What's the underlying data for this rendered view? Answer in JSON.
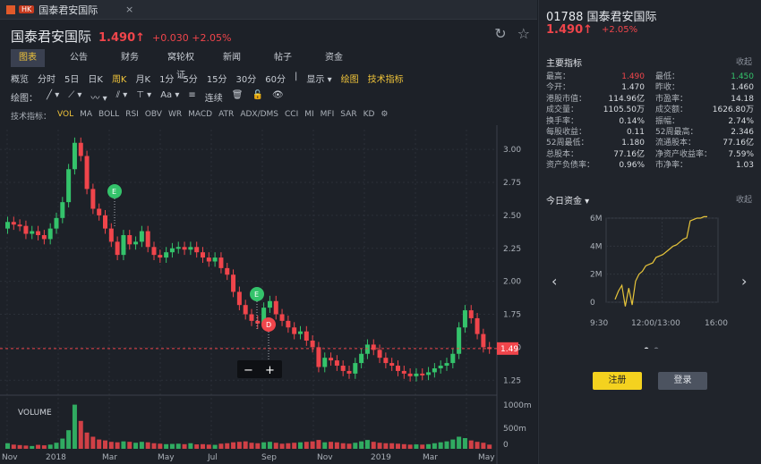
{
  "window": {
    "tab_badge": "HK",
    "title": "国泰君安国际",
    "close": "×"
  },
  "header": {
    "name": "国泰君安国际",
    "price": "1.490↑",
    "change": "+0.030 +2.05%"
  },
  "tabs": [
    "图表",
    "公告",
    "财务",
    "窝轮权证",
    "新闻",
    "帖子",
    "资金"
  ],
  "periods": [
    "概览",
    "分时",
    "5日",
    "日K",
    "周K",
    "月K",
    "1分",
    "5分",
    "15分",
    "30分",
    "60分",
    "|",
    "显示 ▾",
    "绘图",
    "技术指标"
  ],
  "draw": {
    "label": "绘图：",
    "connect": "连续"
  },
  "indicators": {
    "label": "技术指标：",
    "items": [
      "VOL",
      "MA",
      "BOLL",
      "RSI",
      "OBV",
      "WR",
      "MACD",
      "ATR",
      "ADX/DMS",
      "CCI",
      "MI",
      "MFI",
      "SAR",
      "KD"
    ]
  },
  "chart_data": {
    "type": "candlestick",
    "y_ticks": [
      "3.00",
      "2.75",
      "2.50",
      "2.25",
      "2.00",
      "1.75",
      "1.50",
      "1.25"
    ],
    "ylim": [
      1.15,
      3.15
    ],
    "current_price_label": "1.49",
    "volume_label": "VOLUME",
    "volume_ticks": [
      "1000m",
      "500m",
      "0"
    ],
    "x_labels": [
      "Nov",
      "2018",
      "Mar",
      "May",
      "Jul",
      "Sep",
      "Nov",
      "2019",
      "Mar",
      "May"
    ],
    "markers": [
      "E",
      "E",
      "D"
    ],
    "closes": [
      2.45,
      2.43,
      2.42,
      2.36,
      2.38,
      2.35,
      2.32,
      2.4,
      2.48,
      2.6,
      2.85,
      3.05,
      2.95,
      2.7,
      2.55,
      2.5,
      2.4,
      2.3,
      2.2,
      2.35,
      2.28,
      2.3,
      2.38,
      2.26,
      2.2,
      2.18,
      2.22,
      2.25,
      2.26,
      2.24,
      2.26,
      2.22,
      2.18,
      2.15,
      2.18,
      2.1,
      2.05,
      1.92,
      1.82,
      1.75,
      1.7,
      1.68,
      1.8,
      1.85,
      1.75,
      1.7,
      1.65,
      1.6,
      1.62,
      1.55,
      1.5,
      1.35,
      1.42,
      1.4,
      1.36,
      1.32,
      1.3,
      1.38,
      1.45,
      1.52,
      1.48,
      1.42,
      1.38,
      1.36,
      1.32,
      1.3,
      1.28,
      1.3,
      1.29,
      1.31,
      1.34,
      1.36,
      1.38,
      1.45,
      1.65,
      1.78,
      1.72,
      1.6,
      1.5,
      1.49
    ],
    "opens": [
      2.4,
      2.45,
      2.43,
      2.42,
      2.36,
      2.38,
      2.35,
      2.32,
      2.4,
      2.48,
      2.6,
      2.85,
      3.05,
      2.95,
      2.7,
      2.55,
      2.5,
      2.4,
      2.3,
      2.2,
      2.35,
      2.28,
      2.3,
      2.38,
      2.26,
      2.2,
      2.18,
      2.22,
      2.25,
      2.26,
      2.24,
      2.26,
      2.22,
      2.18,
      2.15,
      2.18,
      2.1,
      2.05,
      1.92,
      1.82,
      1.75,
      1.7,
      1.68,
      1.8,
      1.85,
      1.75,
      1.7,
      1.65,
      1.6,
      1.62,
      1.55,
      1.5,
      1.35,
      1.42,
      1.4,
      1.36,
      1.32,
      1.3,
      1.38,
      1.45,
      1.52,
      1.48,
      1.42,
      1.38,
      1.36,
      1.32,
      1.3,
      1.28,
      1.3,
      1.29,
      1.31,
      1.34,
      1.36,
      1.38,
      1.45,
      1.65,
      1.78,
      1.72,
      1.6,
      1.5
    ],
    "volumes": [
      120,
      90,
      80,
      70,
      60,
      85,
      75,
      90,
      130,
      220,
      400,
      950,
      600,
      350,
      260,
      200,
      180,
      150,
      140,
      160,
      150,
      130,
      150,
      140,
      120,
      110,
      100,
      105,
      110,
      100,
      120,
      95,
      100,
      90,
      85,
      110,
      120,
      140,
      150,
      160,
      130,
      120,
      140,
      150,
      130,
      110,
      120,
      130,
      140,
      150,
      160,
      190,
      140,
      150,
      140,
      120,
      110,
      130,
      160,
      190,
      150,
      130,
      120,
      120,
      110,
      100,
      90,
      95,
      90,
      100,
      120,
      140,
      160,
      200,
      260,
      230,
      180,
      150,
      130,
      90
    ],
    "zoom_out": "−",
    "zoom_in": "+"
  },
  "panel": {
    "code": "01788",
    "name": "国泰君安国际",
    "price": "1.490↑",
    "change": "+2.05%",
    "main_title": "主要指标",
    "collapse": "收起",
    "metrics": [
      [
        "最高：",
        "1.490",
        "最低：",
        "1.450"
      ],
      [
        "今开：",
        "1.470",
        "昨收：",
        "1.460"
      ],
      [
        "港股市值：",
        "114.96亿",
        "市盈率：",
        "14.18"
      ],
      [
        "成交量：",
        "1105.50万",
        "成交额：",
        "1626.80万"
      ],
      [
        "换手率：",
        "0.14%",
        "振幅：",
        "2.74%"
      ],
      [
        "每股收益：",
        "0.11",
        "52周最高：",
        "2.346"
      ],
      [
        "52周最低：",
        "1.180",
        "流通股本：",
        "77.16亿"
      ],
      [
        "总股本：",
        "77.16亿",
        "净资产收益率：",
        "7.59%"
      ],
      [
        "资产负债率：",
        "0.96%",
        "市净率：",
        "1.03"
      ]
    ],
    "fund_title": "今日资金 ▾",
    "fund_collapse": "收起",
    "fund_y": [
      "6M",
      "4M",
      "2M",
      "0"
    ],
    "fund_x": [
      "9:30",
      "12:00/13:00",
      "16:00"
    ],
    "fund_values": [
      0.2,
      0.8,
      1.2,
      -0.3,
      1.0,
      -0.2,
      1.5,
      2.0,
      2.2,
      2.6,
      2.7,
      2.8,
      3.2,
      3.3,
      3.4,
      3.6,
      3.8,
      4.0,
      4.1,
      4.3,
      4.5,
      4.6,
      5.8,
      5.9,
      6.0,
      6.0,
      6.1,
      6.1
    ],
    "register": "注册",
    "login": "登录"
  }
}
